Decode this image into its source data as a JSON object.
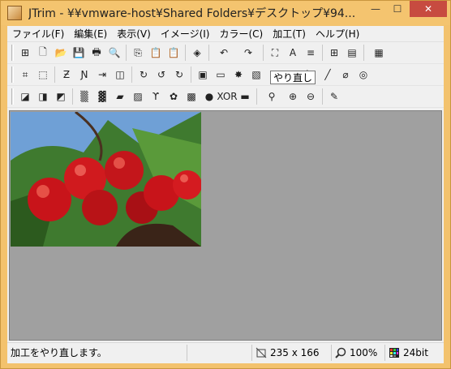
{
  "window": {
    "title": "JTrim - ¥¥vmware-host¥Shared Folders¥デスクトップ¥94...",
    "minimize": "—",
    "maximize": "☐",
    "close": "✕"
  },
  "menu": [
    "ファイル(F)",
    "編集(E)",
    "表示(V)",
    "イメージ(I)",
    "カラー(C)",
    "加工(T)",
    "ヘルプ(H)"
  ],
  "toolbar": {
    "row1": [
      "new-window-icon",
      "new-file-icon",
      "open-folder-icon",
      "save-icon",
      "print-icon",
      "print-preview-icon",
      "copy-icon",
      "paste-icon",
      "paste-new-icon",
      "capture-icon",
      "undo-icon",
      "redo-icon",
      "fit-window-icon",
      "text-icon",
      "blur-lines-icon",
      "grid-layout-icon",
      "film-strip-icon",
      "color-grid-icon"
    ],
    "row1_glyphs": [
      "⊞",
      "🗋",
      "📂",
      "💾",
      "🖶",
      "🔍",
      "⎘",
      "📋",
      "📋",
      "◈",
      "↶",
      "↷",
      "⛶",
      "A",
      "≡",
      "⊞",
      "▤",
      "▦"
    ],
    "row2_glyphs": [
      "⌗",
      "⬚",
      "Ƶ",
      "Ɲ",
      "⇥",
      "◫",
      "↻",
      "↺",
      "↻",
      "▣",
      "▭",
      "✸",
      "▧",
      "▦",
      "✺",
      "ʮ",
      "╱",
      "⌀",
      "◎"
    ],
    "row3_glyphs": [
      "◪",
      "◨",
      "◩",
      "▒",
      "▓",
      "▰",
      "▨",
      "ϒ",
      "✿",
      "▩",
      "●",
      "XOR",
      "▬",
      "⚲",
      "⊕",
      "⊖",
      "✎"
    ],
    "tooltip": "やり直し"
  },
  "status": {
    "message": "加工をやり直します。",
    "size": "235 x 166",
    "zoom": "100%",
    "bit": "24bit"
  },
  "colors": {
    "frame": "#f3c26d",
    "close_button": "#c74b40",
    "canvas_bg": "#a0a0a0"
  }
}
